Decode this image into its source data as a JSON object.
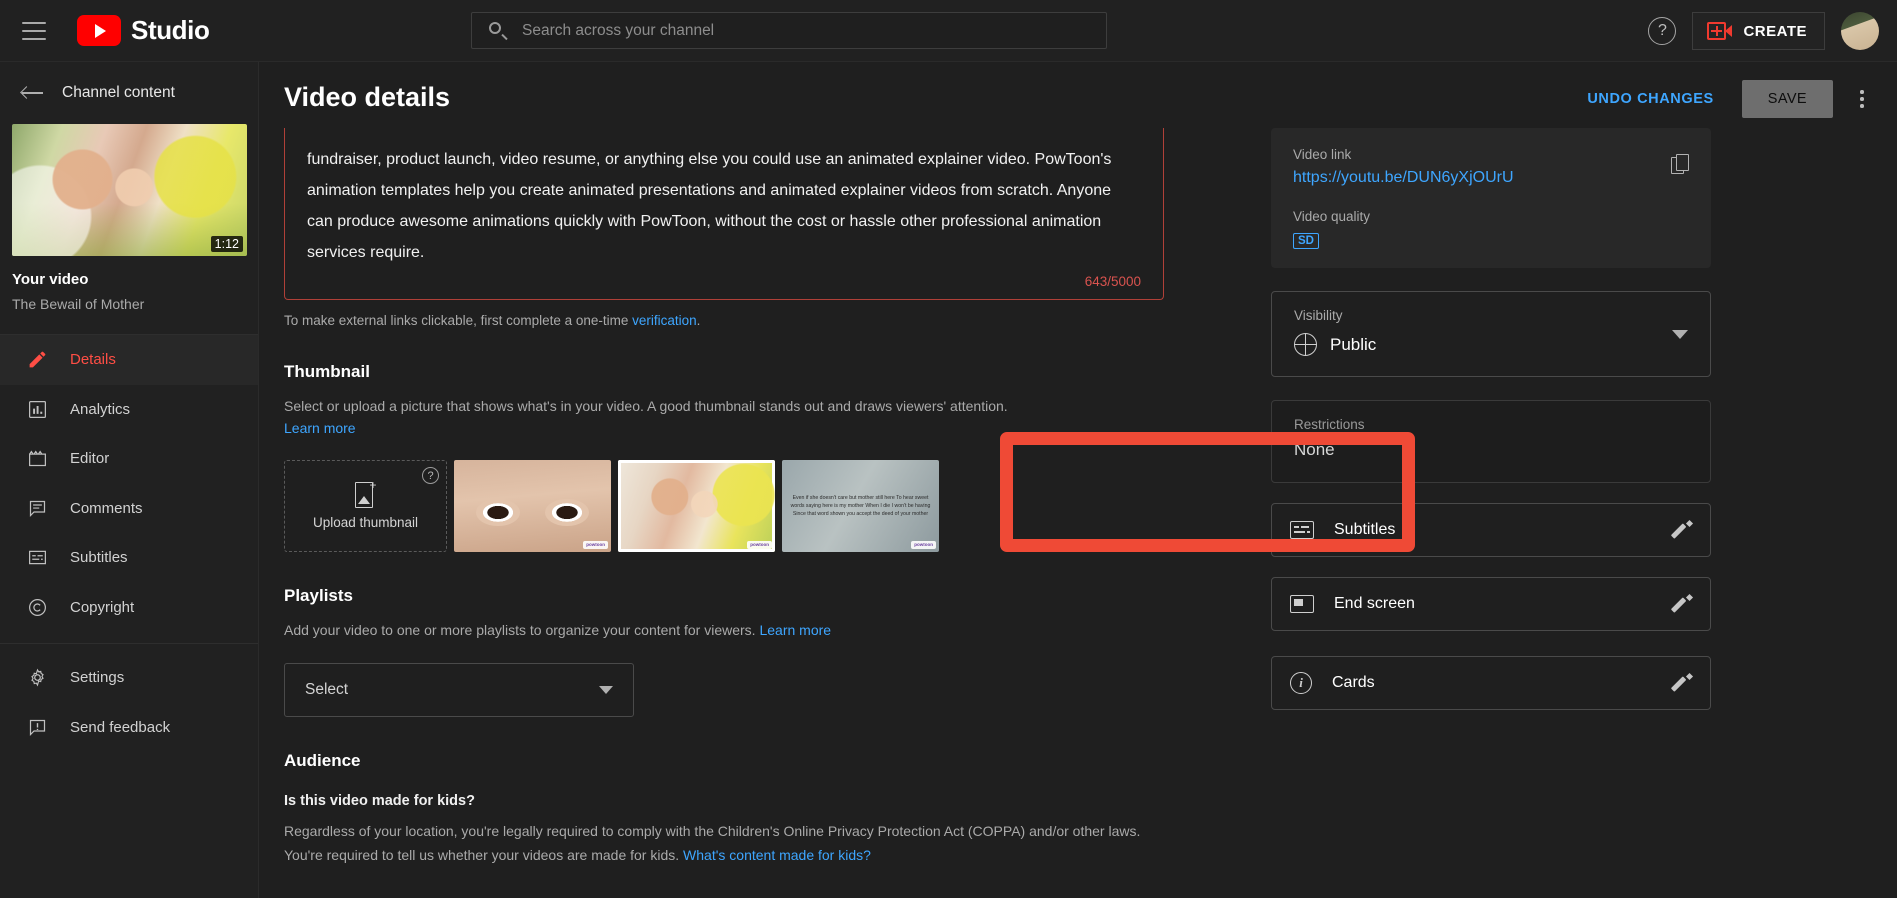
{
  "topbar": {
    "menu_icon": "hamburger-icon",
    "brand": "Studio",
    "search_placeholder": "Search across your channel",
    "search_value": "",
    "help_icon": "question-mark-icon",
    "create_label": "CREATE"
  },
  "sidebar": {
    "back_label": "Channel content",
    "video": {
      "duration": "1:12",
      "label": "Your video",
      "title": "The Bewail of Mother"
    },
    "items": [
      {
        "label": "Details",
        "icon": "pencil-icon",
        "active": true
      },
      {
        "label": "Analytics",
        "icon": "bar-chart-icon",
        "active": false
      },
      {
        "label": "Editor",
        "icon": "clapperboard-icon",
        "active": false
      },
      {
        "label": "Comments",
        "icon": "comment-icon",
        "active": false
      },
      {
        "label": "Subtitles",
        "icon": "subtitles-icon",
        "active": false
      },
      {
        "label": "Copyright",
        "icon": "copyright-icon",
        "active": false
      }
    ],
    "bottom_items": [
      {
        "label": "Settings",
        "icon": "gear-icon"
      },
      {
        "label": "Send feedback",
        "icon": "feedback-icon"
      }
    ]
  },
  "page": {
    "title": "Video details",
    "undo_label": "UNDO CHANGES",
    "save_label": "SAVE",
    "more_icon": "kebab-menu-icon"
  },
  "description": {
    "text": "fundraiser, product launch, video resume, or anything else you could use an animated explainer video. PowToon's animation templates help you create animated presentations and animated explainer videos from scratch.  Anyone can produce awesome animations quickly with PowToon, without the cost or hassle other professional animation services require.",
    "char_count": "643/5000",
    "verify_text": "To make external links clickable, first complete a one-time ",
    "verify_link": "verification",
    "verify_tail": "."
  },
  "thumbnail": {
    "heading": "Thumbnail",
    "description": "Select or upload a picture that shows what's in your video. A good thumbnail stands out and draws viewers' attention.",
    "learn_more": "Learn more",
    "upload_label": "Upload thumbnail",
    "help_icon": "question-mark-icon",
    "options": [
      {
        "name": "thumbnail-option-eyes",
        "selected": false
      },
      {
        "name": "thumbnail-option-kiss",
        "selected": true
      },
      {
        "name": "thumbnail-option-quote",
        "selected": false,
        "text": "Even if she doesn't care but mother still here To hear sweet words saying here is my mother When I die I won't be having Since that word shown you accept the deed of your mother"
      }
    ],
    "watermark": "powtoon"
  },
  "playlists": {
    "heading": "Playlists",
    "description": "Add your video to one or more playlists to organize your content for viewers. ",
    "learn_more": "Learn more",
    "select_value": "Select"
  },
  "audience": {
    "heading": "Audience",
    "question": "Is this video made for kids?",
    "legal": "Regardless of your location, you're legally required to comply with the Children's Online Privacy Protection Act (COPPA) and/or other laws. You're required to tell us whether your videos are made for kids. ",
    "legal_link": "What's content made for kids?"
  },
  "right_panel": {
    "video_link_label": "Video link",
    "video_link_url": "https://youtu.be/DUN6yXjOUrU",
    "copy_icon": "copy-icon",
    "video_quality_label": "Video quality",
    "video_quality_value": "SD",
    "visibility_label": "Visibility",
    "visibility_value": "Public",
    "visibility_icon": "globe-icon",
    "restrictions_label": "Restrictions",
    "restrictions_value": "None",
    "features": [
      {
        "label": "Subtitles",
        "icon": "subtitles-icon",
        "edit_icon": "pencil-icon",
        "highlighted": true
      },
      {
        "label": "End screen",
        "icon": "end-screen-icon",
        "edit_icon": "pencil-icon",
        "highlighted": false
      },
      {
        "label": "Cards",
        "icon": "info-icon",
        "edit_icon": "pencil-icon",
        "highlighted": false
      }
    ]
  },
  "colors": {
    "accent_red": "#ff4e45",
    "highlight_red": "#ef4a36",
    "link_blue": "#3ea6ff",
    "background": "#1f1f1f",
    "surface": "#282828"
  }
}
